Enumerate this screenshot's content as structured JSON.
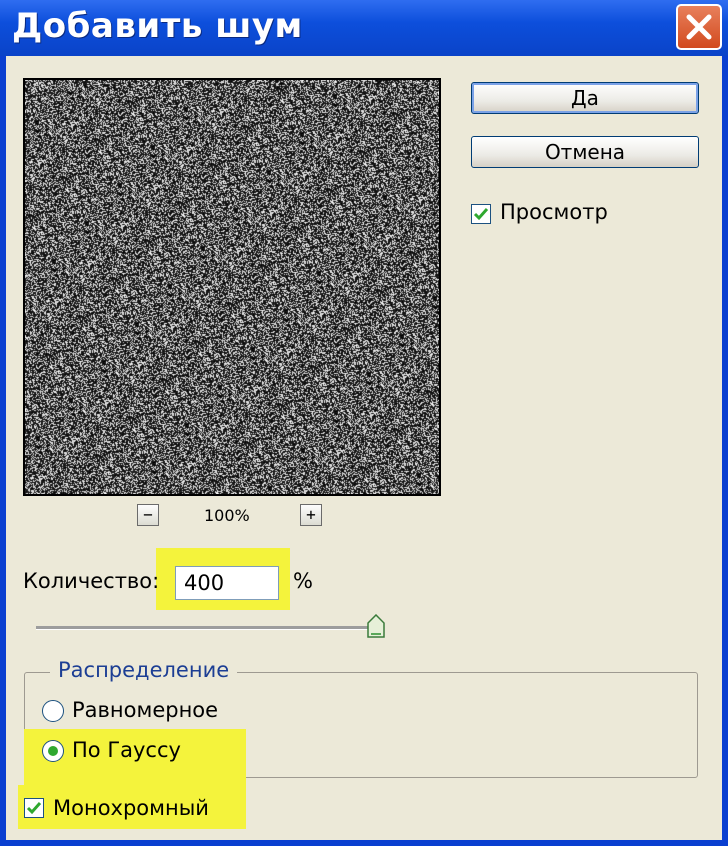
{
  "window": {
    "title": "Добавить шум"
  },
  "buttons": {
    "ok": "Да",
    "cancel": "Отмена"
  },
  "preview_check": {
    "label": "Просмотр",
    "checked": true
  },
  "zoom": {
    "level": "100%",
    "minus": "−",
    "plus": "+"
  },
  "amount": {
    "label": "Количество:",
    "value": "400",
    "unit": "%",
    "slider_fraction": 1.0
  },
  "distribution": {
    "title": "Распределение",
    "options": [
      {
        "label": "Равномерное",
        "selected": false
      },
      {
        "label": "По Гауссу",
        "selected": true
      }
    ]
  },
  "monochrome": {
    "label": "Монохромный",
    "checked": true
  },
  "colors": {
    "highlight": "#f4f33c",
    "title_bar": "#0d4fdc",
    "check_green": "#2fa82f",
    "dialog_bg": "#ece9d8"
  }
}
